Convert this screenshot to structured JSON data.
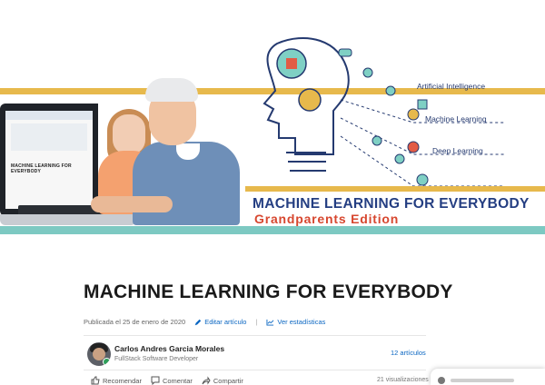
{
  "banner": {
    "title": "MACHINE LEARNING FOR EVERYBODY",
    "subtitle": "Grandparents Edition",
    "topics": [
      "Artificial Intelligence",
      "Machine Learning",
      "Deep Learning"
    ],
    "laptop_text": "MACHINE LEARNING FOR EVERYBODY"
  },
  "article": {
    "title": "MACHINE LEARNING FOR EVERYBODY",
    "published": "Publicada el 25 de enero de 2020",
    "edit_label": "Editar artículo",
    "stats_label": "Ver estadísticas"
  },
  "author": {
    "name": "Carlos Andres Garcia Morales",
    "role": "FullStack Software Developer",
    "articles": "12 artículos"
  },
  "actions": {
    "like": "Recomendar",
    "comment": "Comentar",
    "share": "Compartir",
    "views": "21 visualizaciones"
  },
  "colors": {
    "brand_blue": "#243e82",
    "brand_red": "#d7472f",
    "stripe_yellow": "#e7b94c",
    "stripe_teal": "#7dc9c2",
    "link_blue": "#0a66c2"
  }
}
